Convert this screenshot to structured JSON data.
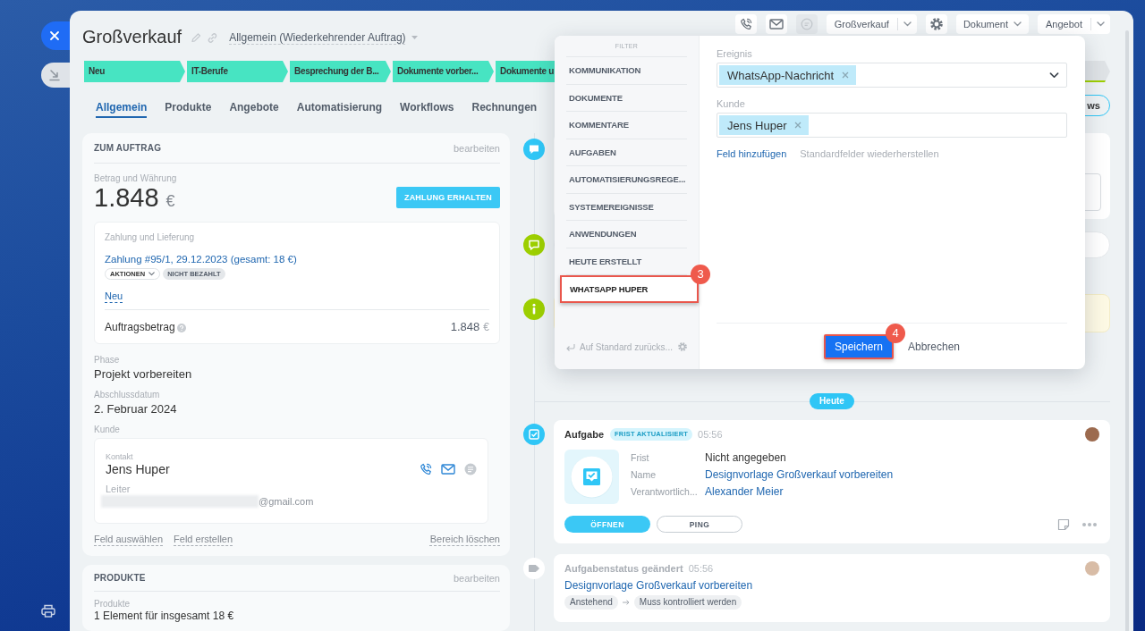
{
  "header": {
    "title": "Großverkauf",
    "pipeline": "Allgemein (Wiederkehrender Auftrag)",
    "toolbar": [
      {
        "kind": "icon",
        "disabled": false
      },
      {
        "kind": "icon",
        "disabled": false
      },
      {
        "kind": "icon",
        "disabled": true
      },
      {
        "kind": "split",
        "label": "Großverkauf",
        "disabled": false
      },
      {
        "kind": "icon",
        "disabled": false
      },
      {
        "kind": "dropdown",
        "label": "Dokument",
        "disabled": false
      },
      {
        "kind": "split",
        "label": "Angebot",
        "disabled": false
      }
    ]
  },
  "stages": [
    {
      "kind": "step",
      "label": "Neu",
      "reached": true
    },
    {
      "kind": "step",
      "label": "IT-Berufe",
      "reached": true
    },
    {
      "kind": "step",
      "label": "Besprechung der B...",
      "reached": true
    },
    {
      "kind": "step",
      "label": "Dokumente vorber...",
      "reached": true
    },
    {
      "kind": "step",
      "label": "Dokumente u",
      "reached": true
    },
    {
      "kind": "final",
      "reached": false
    }
  ],
  "tabs": [
    {
      "label": "Allgemein",
      "selected": true
    },
    {
      "label": "Produkte",
      "selected": false
    },
    {
      "label": "Angebote",
      "selected": false
    },
    {
      "label": "Automatisierung",
      "selected": false
    },
    {
      "label": "Workflows",
      "selected": false
    },
    {
      "label": "Rechnungen",
      "selected": false
    }
  ],
  "tab_bar_button": "ws",
  "order_card": {
    "title": "ZUM AUFTRAG",
    "edit": "bearbeiten",
    "amount_label": "Betrag und Währung",
    "amount": "1.848",
    "currency": "€",
    "pay_button": "ZAHLUNG ERHALTEN",
    "payment": {
      "label": "Zahlung und Lieferung",
      "link": "Zahlung #95/1, 29.12.2023 (gesamt: 18 €)",
      "actions": "AKTIONEN",
      "status": "NICHT BEZAHLT",
      "new_link": "Neu",
      "total_label": "Auftragsbetrag",
      "total": "1.848",
      "total_currency": "€"
    },
    "fields": [
      {
        "label": "Phase",
        "value": "Projekt vorbereiten"
      },
      {
        "label": "Abschlussdatum",
        "value": "2. Februar 2024"
      }
    ],
    "client_label": "Kunde",
    "client": {
      "contact_label": "Kontakt",
      "name": "Jens Huper",
      "role_label": "Leiter",
      "email": "@gmail.com"
    },
    "footer_links": [
      "Feld auswählen",
      "Feld erstellen"
    ],
    "clear_link": "Bereich löschen"
  },
  "products_card": {
    "title": "PRODUKTE",
    "edit": "bearbeiten",
    "label": "Produkte",
    "value": "1 Element für insgesamt 18 €"
  },
  "timeline": {
    "history": [
      {
        "kind": "comment"
      },
      {
        "kind": "message"
      },
      {
        "kind": "info"
      }
    ],
    "day_label": "Heute",
    "task": {
      "title": "Aufgabe",
      "badge": "FRIST AKTUALISIERT",
      "time": "05:56",
      "fields": [
        {
          "label": "Frist",
          "value": "Nicht angegeben",
          "link": false
        },
        {
          "label": "Name",
          "value": "Designvorlage Großverkauf vorbereiten",
          "link": true
        },
        {
          "label": "Verantwortlich...",
          "value": "Alexander Meier",
          "link": true
        }
      ],
      "buttons": [
        {
          "label": "ÖFFNEN",
          "primary": true
        },
        {
          "label": "PING",
          "primary": false
        }
      ]
    },
    "status_change": {
      "title": "Aufgabenstatus geändert",
      "time": "05:56",
      "link": "Designvorlage Großverkauf vorbereiten",
      "from": "Anstehend",
      "to": "Muss kontrolliert werden"
    }
  },
  "filter_popup": {
    "caption": "FILTER",
    "filters": [
      {
        "label": "KOMMUNIKATION",
        "selected": false
      },
      {
        "label": "DOKUMENTE",
        "selected": false
      },
      {
        "label": "KOMMENTARE",
        "selected": false
      },
      {
        "label": "AUFGABEN",
        "selected": false
      },
      {
        "label": "AUTOMATISIERUNGSREGE...",
        "selected": false
      },
      {
        "label": "SYSTEMEREIGNISSE",
        "selected": false
      },
      {
        "label": "ANWENDUNGEN",
        "selected": false
      },
      {
        "label": "HEUTE ERSTELLT",
        "selected": false
      },
      {
        "label": "WHATSAPP HUPER",
        "selected": true,
        "callout": "3"
      }
    ],
    "reset": "Auf Standard zurücks...",
    "fields": [
      {
        "label": "Ereignis",
        "tags": [
          "WhatsApp-Nachricht"
        ],
        "dropdown": true
      },
      {
        "label": "Kunde",
        "tags": [
          "Jens Huper"
        ],
        "dropdown": false
      }
    ],
    "add_field": "Feld hinzufügen",
    "restore": "Standardfelder wiederherstellen",
    "save": {
      "label": "Speichern",
      "callout": "4"
    },
    "cancel": "Abbrechen"
  }
}
